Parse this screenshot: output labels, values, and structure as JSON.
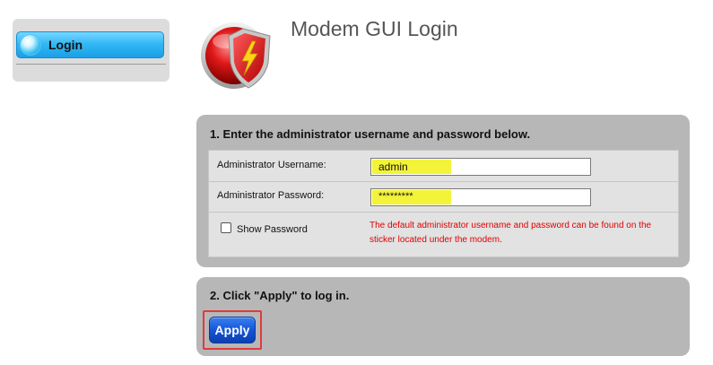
{
  "sidebar": {
    "items": [
      {
        "label": "Login",
        "icon": "orb-icon",
        "active": true
      }
    ]
  },
  "header": {
    "title": "Modem GUI Login",
    "logo_icon": "shield-lightning-icon"
  },
  "step1": {
    "heading": "1. Enter the administrator username and password below.",
    "username_label": "Administrator Username:",
    "username_value": "admin",
    "password_label": "Administrator Password:",
    "password_value": "*********",
    "show_password_label": "Show Password",
    "show_password_checked": false,
    "hint": "The default administrator username and password can be found on the sticker located under the modem."
  },
  "step2": {
    "heading": "2. Click \"Apply\" to log in.",
    "apply_label": "Apply"
  },
  "colors": {
    "panel_bg": "#b7b7b7",
    "form_bg": "#e2e2e2",
    "hint_text": "#e00000",
    "input_highlight": "#f3f33a",
    "apply_button": "#1556d6",
    "focus_frame": "#e23a3a",
    "nav_active": "#33b8f5"
  }
}
